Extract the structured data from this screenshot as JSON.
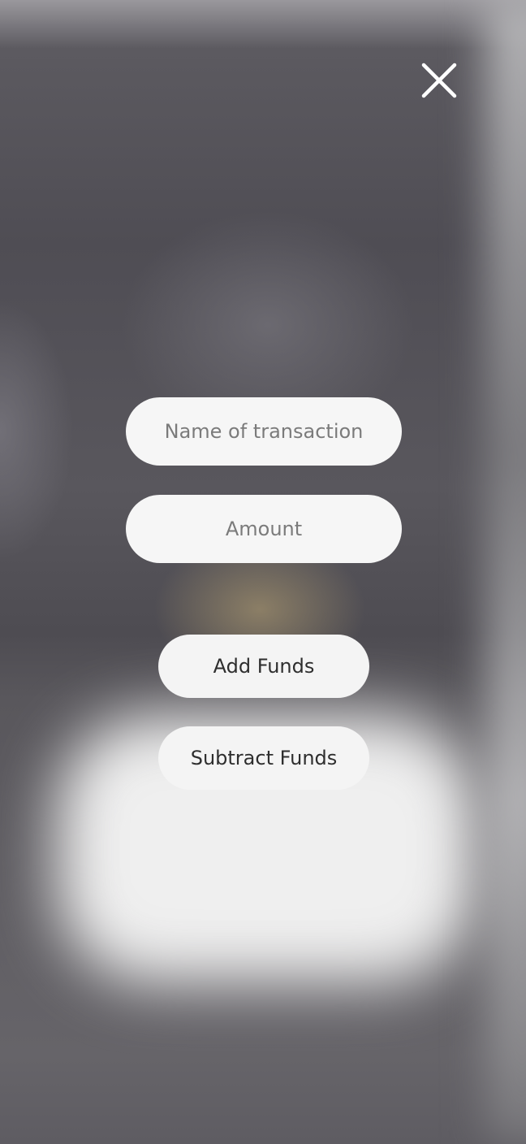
{
  "close": {
    "icon": "close-icon"
  },
  "form": {
    "name_field": {
      "placeholder": "Name of transaction",
      "value": ""
    },
    "amount_field": {
      "placeholder": "Amount",
      "value": ""
    },
    "add_label": "Add Funds",
    "subtract_label": "Subtract Funds"
  },
  "colors": {
    "field_background": "#f6f6f6",
    "placeholder_text": "#7b7b7b",
    "button_text": "#2e2e2e",
    "icon": "#ffffff"
  }
}
